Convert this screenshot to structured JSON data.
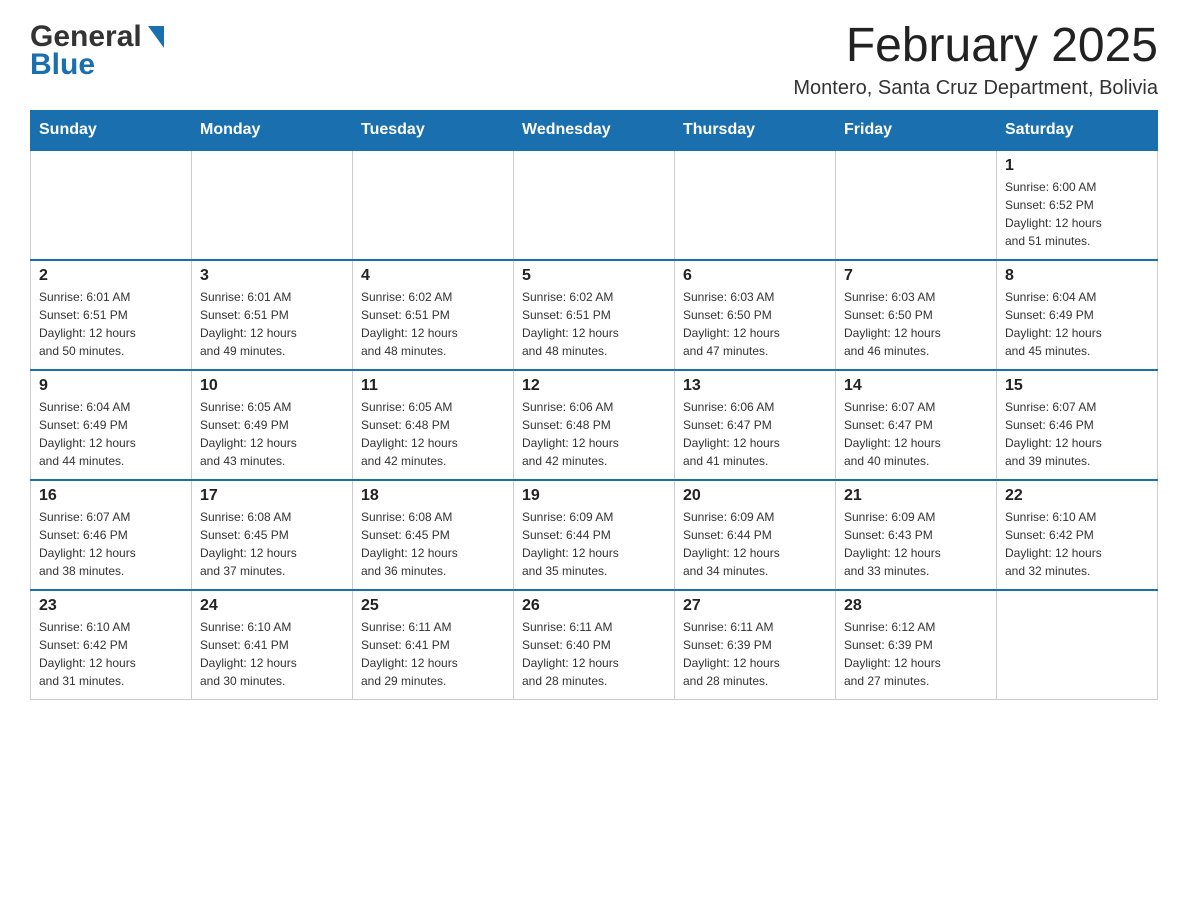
{
  "header": {
    "logo_general": "General",
    "logo_blue": "Blue",
    "month_title": "February 2025",
    "location": "Montero, Santa Cruz Department, Bolivia"
  },
  "days_of_week": [
    "Sunday",
    "Monday",
    "Tuesday",
    "Wednesday",
    "Thursday",
    "Friday",
    "Saturday"
  ],
  "weeks": [
    [
      {
        "day": "",
        "info": ""
      },
      {
        "day": "",
        "info": ""
      },
      {
        "day": "",
        "info": ""
      },
      {
        "day": "",
        "info": ""
      },
      {
        "day": "",
        "info": ""
      },
      {
        "day": "",
        "info": ""
      },
      {
        "day": "1",
        "info": "Sunrise: 6:00 AM\nSunset: 6:52 PM\nDaylight: 12 hours\nand 51 minutes."
      }
    ],
    [
      {
        "day": "2",
        "info": "Sunrise: 6:01 AM\nSunset: 6:51 PM\nDaylight: 12 hours\nand 50 minutes."
      },
      {
        "day": "3",
        "info": "Sunrise: 6:01 AM\nSunset: 6:51 PM\nDaylight: 12 hours\nand 49 minutes."
      },
      {
        "day": "4",
        "info": "Sunrise: 6:02 AM\nSunset: 6:51 PM\nDaylight: 12 hours\nand 48 minutes."
      },
      {
        "day": "5",
        "info": "Sunrise: 6:02 AM\nSunset: 6:51 PM\nDaylight: 12 hours\nand 48 minutes."
      },
      {
        "day": "6",
        "info": "Sunrise: 6:03 AM\nSunset: 6:50 PM\nDaylight: 12 hours\nand 47 minutes."
      },
      {
        "day": "7",
        "info": "Sunrise: 6:03 AM\nSunset: 6:50 PM\nDaylight: 12 hours\nand 46 minutes."
      },
      {
        "day": "8",
        "info": "Sunrise: 6:04 AM\nSunset: 6:49 PM\nDaylight: 12 hours\nand 45 minutes."
      }
    ],
    [
      {
        "day": "9",
        "info": "Sunrise: 6:04 AM\nSunset: 6:49 PM\nDaylight: 12 hours\nand 44 minutes."
      },
      {
        "day": "10",
        "info": "Sunrise: 6:05 AM\nSunset: 6:49 PM\nDaylight: 12 hours\nand 43 minutes."
      },
      {
        "day": "11",
        "info": "Sunrise: 6:05 AM\nSunset: 6:48 PM\nDaylight: 12 hours\nand 42 minutes."
      },
      {
        "day": "12",
        "info": "Sunrise: 6:06 AM\nSunset: 6:48 PM\nDaylight: 12 hours\nand 42 minutes."
      },
      {
        "day": "13",
        "info": "Sunrise: 6:06 AM\nSunset: 6:47 PM\nDaylight: 12 hours\nand 41 minutes."
      },
      {
        "day": "14",
        "info": "Sunrise: 6:07 AM\nSunset: 6:47 PM\nDaylight: 12 hours\nand 40 minutes."
      },
      {
        "day": "15",
        "info": "Sunrise: 6:07 AM\nSunset: 6:46 PM\nDaylight: 12 hours\nand 39 minutes."
      }
    ],
    [
      {
        "day": "16",
        "info": "Sunrise: 6:07 AM\nSunset: 6:46 PM\nDaylight: 12 hours\nand 38 minutes."
      },
      {
        "day": "17",
        "info": "Sunrise: 6:08 AM\nSunset: 6:45 PM\nDaylight: 12 hours\nand 37 minutes."
      },
      {
        "day": "18",
        "info": "Sunrise: 6:08 AM\nSunset: 6:45 PM\nDaylight: 12 hours\nand 36 minutes."
      },
      {
        "day": "19",
        "info": "Sunrise: 6:09 AM\nSunset: 6:44 PM\nDaylight: 12 hours\nand 35 minutes."
      },
      {
        "day": "20",
        "info": "Sunrise: 6:09 AM\nSunset: 6:44 PM\nDaylight: 12 hours\nand 34 minutes."
      },
      {
        "day": "21",
        "info": "Sunrise: 6:09 AM\nSunset: 6:43 PM\nDaylight: 12 hours\nand 33 minutes."
      },
      {
        "day": "22",
        "info": "Sunrise: 6:10 AM\nSunset: 6:42 PM\nDaylight: 12 hours\nand 32 minutes."
      }
    ],
    [
      {
        "day": "23",
        "info": "Sunrise: 6:10 AM\nSunset: 6:42 PM\nDaylight: 12 hours\nand 31 minutes."
      },
      {
        "day": "24",
        "info": "Sunrise: 6:10 AM\nSunset: 6:41 PM\nDaylight: 12 hours\nand 30 minutes."
      },
      {
        "day": "25",
        "info": "Sunrise: 6:11 AM\nSunset: 6:41 PM\nDaylight: 12 hours\nand 29 minutes."
      },
      {
        "day": "26",
        "info": "Sunrise: 6:11 AM\nSunset: 6:40 PM\nDaylight: 12 hours\nand 28 minutes."
      },
      {
        "day": "27",
        "info": "Sunrise: 6:11 AM\nSunset: 6:39 PM\nDaylight: 12 hours\nand 28 minutes."
      },
      {
        "day": "28",
        "info": "Sunrise: 6:12 AM\nSunset: 6:39 PM\nDaylight: 12 hours\nand 27 minutes."
      },
      {
        "day": "",
        "info": ""
      }
    ]
  ]
}
